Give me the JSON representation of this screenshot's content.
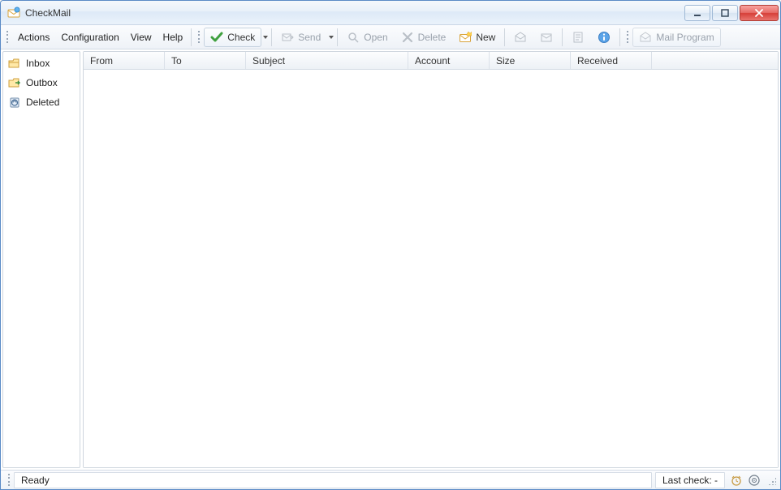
{
  "app": {
    "title": "CheckMail"
  },
  "menu": {
    "actions": "Actions",
    "configuration": "Configuration",
    "view": "View",
    "help": "Help"
  },
  "toolbar": {
    "check": "Check",
    "send": "Send",
    "open": "Open",
    "delete": "Delete",
    "new": "New",
    "mail_program": "Mail Program"
  },
  "sidebar": {
    "inbox": "Inbox",
    "outbox": "Outbox",
    "deleted": "Deleted"
  },
  "columns": {
    "from": "From",
    "to": "To",
    "subject": "Subject",
    "account": "Account",
    "size": "Size",
    "received": "Received"
  },
  "status": {
    "ready": "Ready",
    "last_check": "Last check: -"
  }
}
